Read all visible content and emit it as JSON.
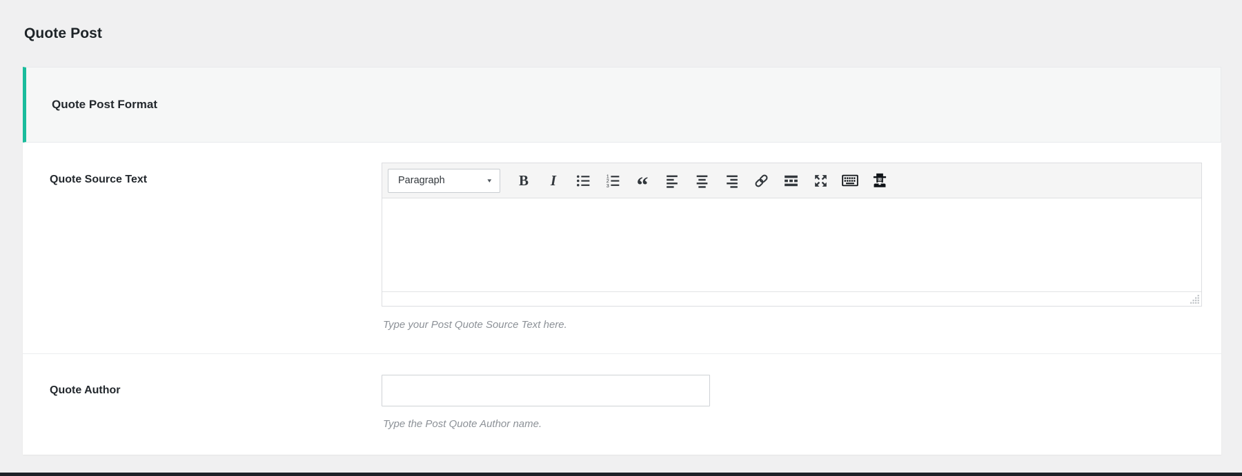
{
  "page": {
    "title": "Quote Post"
  },
  "metabox": {
    "section_title": "Quote Post Format",
    "accent_color": "#1abc9c",
    "fields": [
      {
        "label": "Quote Source Text",
        "help": "Type your Post Quote Source Text here.",
        "value": ""
      },
      {
        "label": "Quote Author",
        "help": "Type the Post Quote Author name.",
        "value": "",
        "placeholder": ""
      }
    ]
  },
  "editor": {
    "format_select_value": "Paragraph",
    "toolbar": {
      "bold_glyph": "B",
      "italic_glyph": "I",
      "blockquote_glyph": "“",
      "numbered_digits": [
        "1",
        "2",
        "3"
      ],
      "caret_glyph": "▾",
      "buttons": [
        "format-select",
        "bold",
        "italic",
        "bulleted-list",
        "numbered-list",
        "blockquote",
        "align-left",
        "align-center",
        "align-right",
        "insert-link",
        "read-more",
        "fullscreen",
        "keyboard",
        "hat-person"
      ]
    },
    "icons": {
      "chevron_down": "chevron-down-icon",
      "bulleted_list": "bulleted-list-icon",
      "numbered_list": "numbered-list-icon",
      "align_left": "align-left-icon",
      "align_center": "align-center-icon",
      "align_right": "align-right-icon",
      "link": "link-icon",
      "read_more": "read-more-icon",
      "fullscreen": "fullscreen-icon",
      "keyboard": "keyboard-icon",
      "hat_person": "hat-person-icon",
      "resize_grip": "resize-grip-icon"
    }
  },
  "colors": {
    "page_background": "#f0f0f1",
    "section_header_background": "#f6f7f7",
    "accent_green": "#1abc9c",
    "icon_gray": "#32373c",
    "icon_black": "#101418",
    "help_text_gray": "#8c9197"
  }
}
